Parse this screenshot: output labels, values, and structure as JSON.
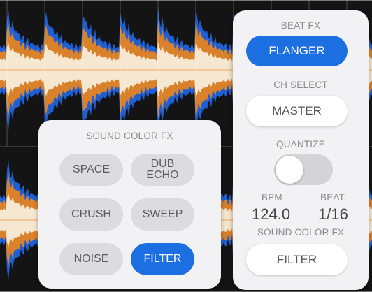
{
  "beat_fx": {
    "label": "BEAT FX",
    "effect": "FLANGER",
    "ch_select_label": "CH SELECT",
    "ch_select": "MASTER",
    "quantize_label": "QUANTIZE",
    "quantize_on": false,
    "bpm_label": "BPM",
    "bpm": "124.0",
    "beat_label": "BEAT",
    "beat": "1/16",
    "sound_color_label": "SOUND COLOR FX",
    "sound_color_value": "FILTER"
  },
  "sound_color_fx": {
    "title": "SOUND COLOR FX",
    "buttons": [
      {
        "label": "SPACE",
        "active": false
      },
      {
        "label": "DUB\nECHO",
        "active": false
      },
      {
        "label": "CRUSH",
        "active": false
      },
      {
        "label": "SWEEP",
        "active": false
      },
      {
        "label": "NOISE",
        "active": false
      },
      {
        "label": "FILTER",
        "active": true
      }
    ]
  },
  "colors": {
    "accent": "#1b6fe0",
    "wave_blue": "#1f5fd6",
    "wave_orange": "#d9822b",
    "wave_cream": "#f6e7d0"
  }
}
